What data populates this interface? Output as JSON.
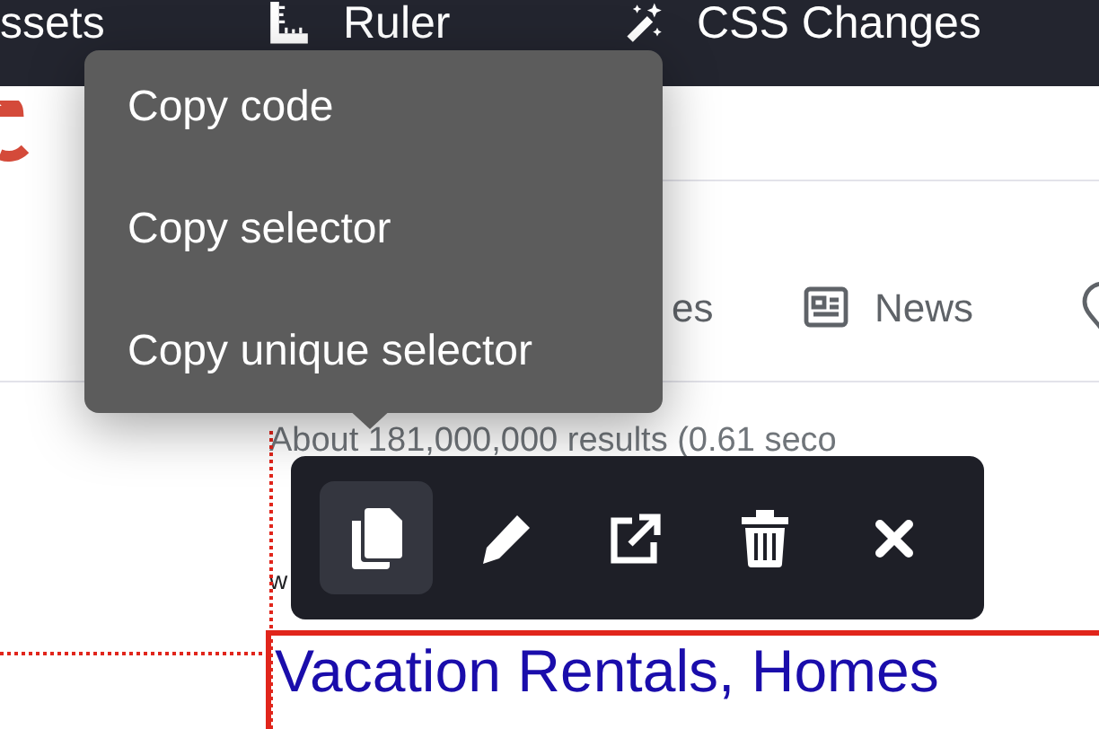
{
  "top_toolbar": [
    {
      "label": "ssets"
    },
    {
      "label": "Ruler",
      "kind": "ruler"
    },
    {
      "label": "CSS Changes",
      "kind": "wand"
    }
  ],
  "search_tabs": [
    {
      "label": "es"
    },
    {
      "label": "News",
      "kind": "news"
    },
    {
      "kind": "pin"
    }
  ],
  "result_stats": "About 181,000,000 results (0.61 seco",
  "snippet_fragment": "w",
  "result_title": "Vacation Rentals, Homes",
  "context_menu": {
    "items": [
      "Copy code",
      "Copy selector",
      "Copy unique selector"
    ]
  },
  "element_toolbar": {
    "buttons": [
      {
        "kind": "copy",
        "selected": true
      },
      {
        "kind": "edit",
        "selected": false
      },
      {
        "kind": "open",
        "selected": false
      },
      {
        "kind": "delete",
        "selected": false
      },
      {
        "kind": "close",
        "selected": false
      }
    ]
  }
}
